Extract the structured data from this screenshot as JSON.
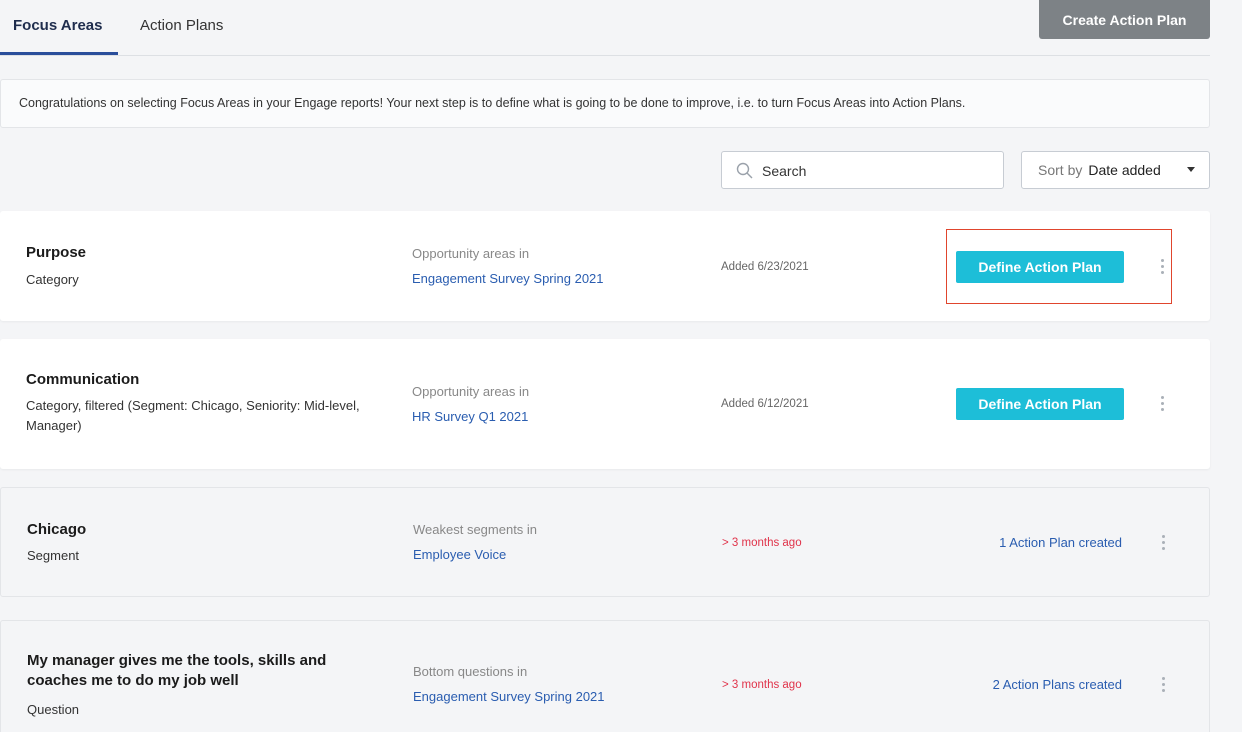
{
  "tabs": [
    {
      "label": "Focus Areas",
      "active": true
    },
    {
      "label": "Action Plans",
      "active": false
    }
  ],
  "create_button": "Create Action Plan",
  "banner": "Congratulations on selecting Focus Areas in your Engage reports! Your next step is to define what is going to be done to improve, i.e. to turn Focus Areas into Action Plans.",
  "search": {
    "placeholder": "Search"
  },
  "sort": {
    "label": "Sort by",
    "value": "Date added"
  },
  "colors": {
    "accent": "#1dbed8",
    "link": "#2a5db0",
    "warning": "#e0334a",
    "tab_active": "#2a4e9b"
  },
  "cards": [
    {
      "title": "Purpose",
      "subtitle": "Category",
      "source_label": "Opportunity areas in",
      "source_link": "Engagement Survey Spring 2021",
      "added": "Added 6/23/2021",
      "action": "Define Action Plan"
    },
    {
      "title": "Communication",
      "subtitle": "Category, filtered (Segment: Chicago, Seniority: Mid-level, Manager)",
      "source_label": "Opportunity areas in",
      "source_link": "HR Survey Q1 2021",
      "added": "Added 6/12/2021",
      "action": "Define Action Plan"
    },
    {
      "title": "Chicago",
      "subtitle": "Segment",
      "source_label": "Weakest segments in",
      "source_link": "Employee Voice",
      "added": "> 3 months ago",
      "action": "1 Action Plan created"
    },
    {
      "title": "My manager gives me the tools, skills and coaches me to do my job well",
      "subtitle": "Question",
      "source_label": "Bottom questions in",
      "source_link": "Engagement Survey Spring 2021",
      "added": "> 3 months ago",
      "action": "2 Action Plans created"
    }
  ]
}
